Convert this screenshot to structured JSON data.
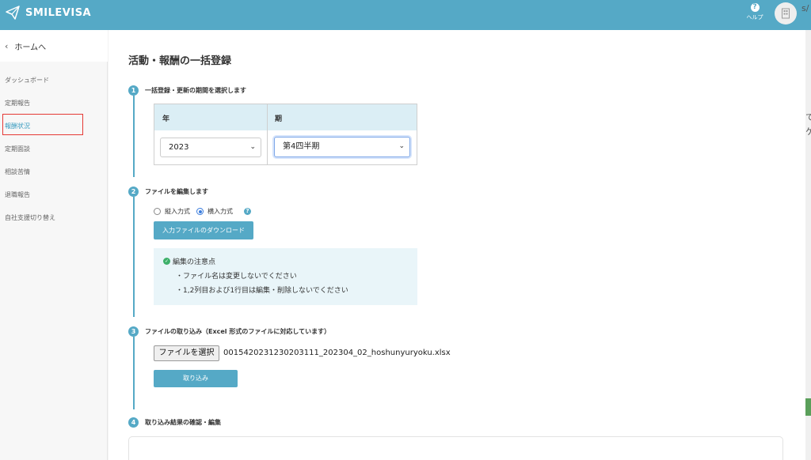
{
  "app": {
    "name": "SMILEVISA"
  },
  "header": {
    "help_label": "ヘルプ",
    "help_glyph": "?"
  },
  "edge_text": {
    "top_right": "s/",
    "right_1": "て",
    "right_2": "ケ"
  },
  "sidebar": {
    "back_label": "ホームへ",
    "items": [
      {
        "label": "ダッシュボード"
      },
      {
        "label": "定期報告"
      },
      {
        "label": "報酬状況"
      },
      {
        "label": "定期面談"
      },
      {
        "label": "相談苦情"
      },
      {
        "label": "退職報告"
      },
      {
        "label": "自社支援切り替え"
      }
    ],
    "active_index": 2
  },
  "page": {
    "title": "活動・報酬の一括登録"
  },
  "steps": [
    {
      "number": "1",
      "title": "一括登録・更新の期間を選択します"
    },
    {
      "number": "2",
      "title": "ファイルを編集します"
    },
    {
      "number": "3",
      "title": "ファイルの取り込み（Excel 形式のファイルに対応しています）"
    },
    {
      "number": "4",
      "title": "取り込み結果の確認・編集"
    }
  ],
  "period": {
    "year_header": "年",
    "term_header": "期",
    "year_value": "2023",
    "term_value": "第4四半期"
  },
  "edit": {
    "radio_vertical": "縦入力式",
    "radio_horizontal": "横入力式",
    "selected": "horizontal",
    "download_button": "入力ファイルのダウンロード",
    "notice_title": "編集の注意点",
    "notice_lines": [
      "・ファイル名は変更しないでください",
      "・1,2列目および1行目は編集・削除しないでください"
    ]
  },
  "import": {
    "file_button": "ファイルを選択",
    "file_name": "0015420231230203111_202304_02_hoshunyuryoku.xlsx",
    "import_button": "取り込み"
  },
  "colors": {
    "accent": "#55a9c6",
    "active_nav": "#3a9cc0",
    "highlight": "#e53935"
  }
}
